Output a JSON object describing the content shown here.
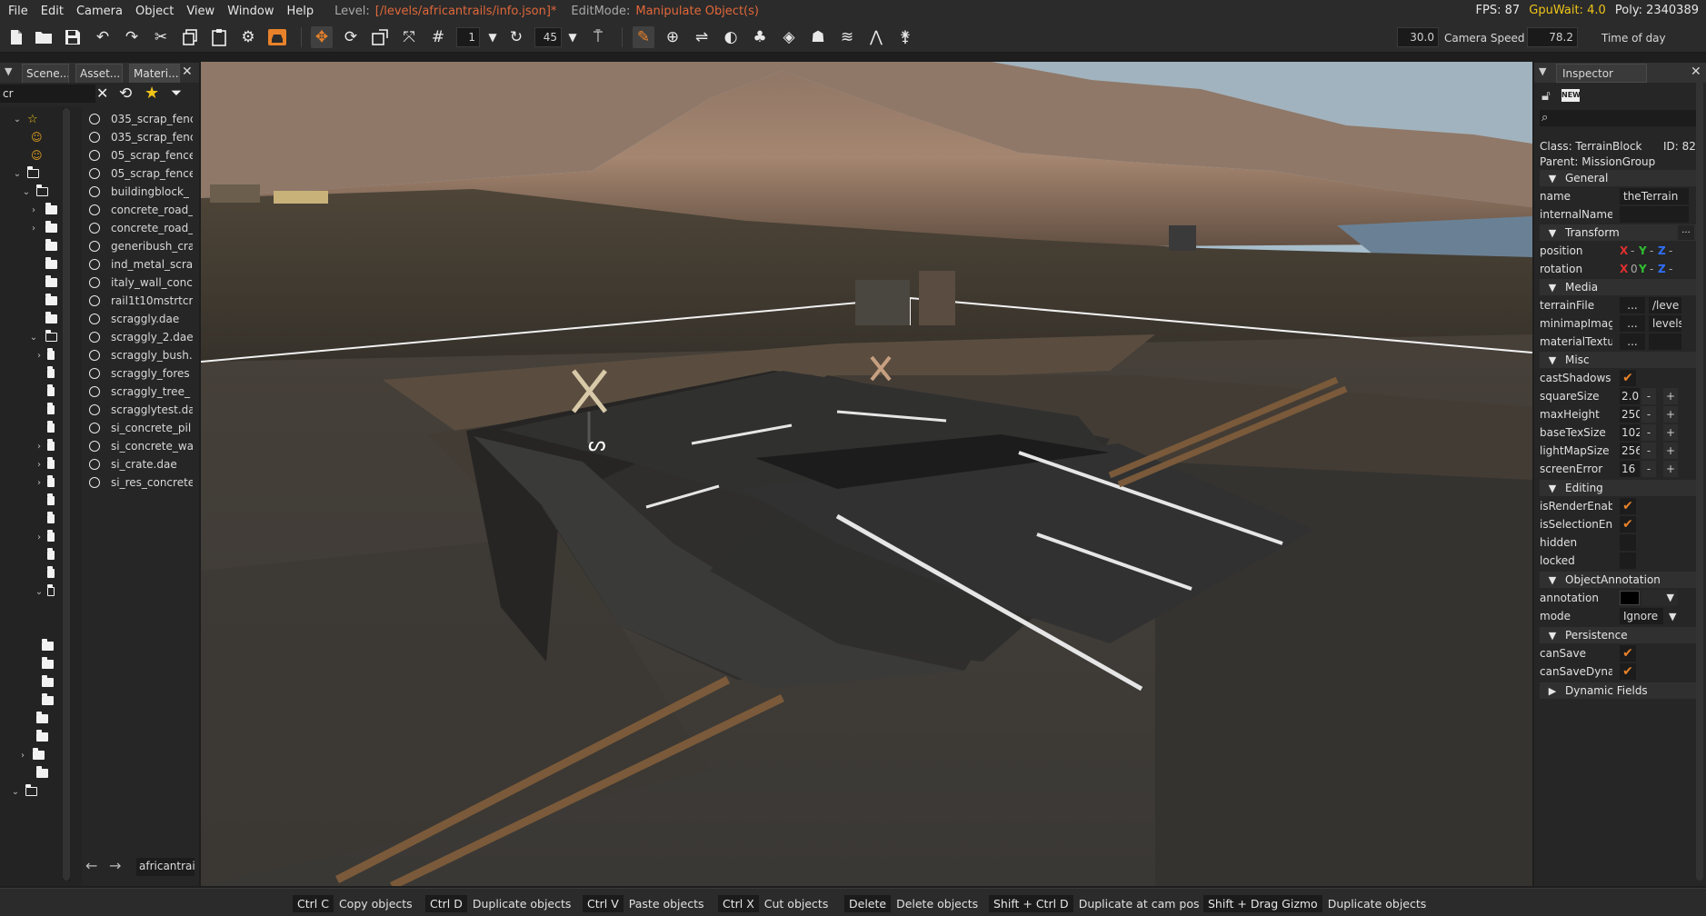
{
  "menubar": {
    "items": [
      "File",
      "Edit",
      "Camera",
      "Object",
      "View",
      "Window",
      "Help"
    ],
    "level_label": "Level:",
    "level_value": "[/levels/africantrails/info.json]*",
    "editmode_label": "EditMode:",
    "editmode_value": "Manipulate Object(s)",
    "fps": "FPS: 87",
    "gpuwait": "GpuWait: 4.0",
    "poly": "Poly: 2340389"
  },
  "toolbar": {
    "snap_value": "1",
    "angle_value": "45",
    "camera_speed_value": "30.0",
    "camera_speed_label": "Camera Speed",
    "time_of_day_value": "78.2",
    "time_of_day_label": "Time of day"
  },
  "leftpanel": {
    "tabs": [
      "Scene...",
      "Asset...",
      "Materi..."
    ],
    "filter_value": "cr",
    "files": [
      "035_scrap_fenc",
      "035_scrap_fenc",
      "05_scrap_fence",
      "05_scrap_fence",
      "buildingblock_",
      "concrete_road_",
      "concrete_road_",
      "generibush_cra",
      "ind_metal_scra",
      "italy_wall_conc",
      "rail1t10mstrtcr",
      "scraggly.dae",
      "scraggly_2.dae",
      "scraggly_bush.",
      "scraggly_fores",
      "scraggly_tree_",
      "scragglytest.da",
      "si_concrete_pil",
      "si_concrete_wa",
      "si_crate.dae",
      "si_res_concrete"
    ],
    "path_value": "africantrai"
  },
  "inspector": {
    "title": "Inspector",
    "class_text": "Class: TerrainBlock",
    "id_text": "ID: 82",
    "parent_text": "Parent: MissionGroup",
    "sections": {
      "general": "General",
      "transform": "Transform",
      "media": "Media",
      "misc": "Misc",
      "editing": "Editing",
      "annotation": "ObjectAnnotation",
      "persistence": "Persistence",
      "dynamic": "Dynamic Fields"
    },
    "fields": {
      "name_label": "name",
      "name_value": "theTerrain",
      "internal_label": "internalName",
      "position_label": "position",
      "rotation_label": "rotation",
      "terrainfile_label": "terrainFile",
      "terrainfile_value": "/leve",
      "minimap_label": "minimapImag",
      "minimap_value": "levels",
      "materialtex_label": "materialTextur",
      "castshadows_label": "castShadows",
      "squaresize_label": "squareSize",
      "squaresize_value": "2.0",
      "maxheight_label": "maxHeight",
      "maxheight_value": "250",
      "basetex_label": "baseTexSize",
      "basetex_value": "102",
      "lightmap_label": "lightMapSize",
      "lightmap_value": "256",
      "screenerror_label": "screenError",
      "screenerror_value": "16",
      "isrender_label": "isRenderEnabl",
      "isselection_label": "isSelectionEna",
      "hidden_label": "hidden",
      "locked_label": "locked",
      "annotation_label": "annotation",
      "mode_label": "mode",
      "mode_value": "Ignore",
      "cansave_label": "canSave",
      "cansavedyn_label": "canSaveDynar"
    },
    "ellipsis": "...",
    "axis_x": "X",
    "axis_y": "Y",
    "axis_z": "Z",
    "axis_sep": "-",
    "rot_x_value": "0"
  },
  "statusbar": {
    "shortcuts": [
      {
        "key": "Ctrl C",
        "action": "Copy objects"
      },
      {
        "key": "Ctrl D",
        "action": "Duplicate objects"
      },
      {
        "key": "Ctrl V",
        "action": "Paste objects"
      },
      {
        "key": "Ctrl X",
        "action": "Cut objects"
      },
      {
        "key": "Delete",
        "action": "Delete objects"
      },
      {
        "key": "Shift + Ctrl D",
        "action": "Duplicate at cam pos"
      },
      {
        "key": "Shift + Drag Gizmo",
        "action": "Duplicate objects"
      }
    ]
  },
  "colors": {
    "accent_orange": "#e8822a",
    "level_orange": "#e0683a",
    "gpu_yellow": "#f0c419",
    "axis_x": "#e03030",
    "axis_y": "#30c030",
    "axis_z": "#3070ff"
  }
}
